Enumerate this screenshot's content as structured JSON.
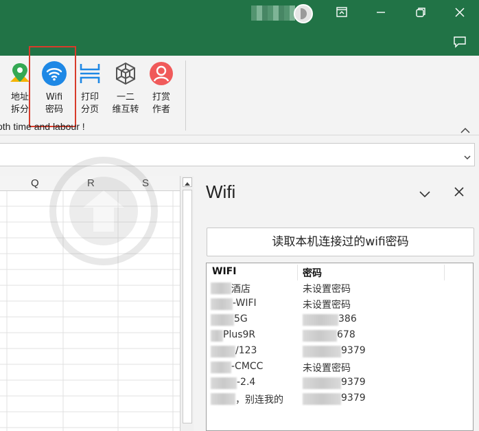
{
  "colors": {
    "titlebar": "#217346",
    "highlight": "#d83b2a",
    "wifi_icon": "#1e88e5"
  },
  "ribbon": {
    "buttons": [
      {
        "label": "地址\n拆分",
        "icon": "map-pin-icon"
      },
      {
        "label": "Wifi\n密码",
        "icon": "wifi-icon"
      },
      {
        "label": "打印\n分页",
        "icon": "page-break-icon"
      },
      {
        "label": "一二\n维互转",
        "icon": "cube-icon"
      },
      {
        "label": "打赏\n作者",
        "icon": "user-icon"
      }
    ],
    "tagline": "oth time and labour !"
  },
  "grid": {
    "columns": [
      "Q",
      "R",
      "S"
    ]
  },
  "pane": {
    "title": "Wifi",
    "read_button": "读取本机连接过的wifi密码",
    "headers": {
      "wifi": "WIFI",
      "password": "密码"
    },
    "rows": [
      {
        "wifi": "酒店",
        "password": "未设置密码"
      },
      {
        "wifi": "-WIFI",
        "password": "未设置密码"
      },
      {
        "wifi": "5G",
        "password": "386"
      },
      {
        "wifi": "Plus9R",
        "password": "678"
      },
      {
        "wifi": "/123",
        "password": "9379"
      },
      {
        "wifi": "-CMCC",
        "password": "未设置密码"
      },
      {
        "wifi": "-2.4",
        "password": "9379"
      },
      {
        "wifi": "，别连我的",
        "password": "9379"
      }
    ]
  }
}
